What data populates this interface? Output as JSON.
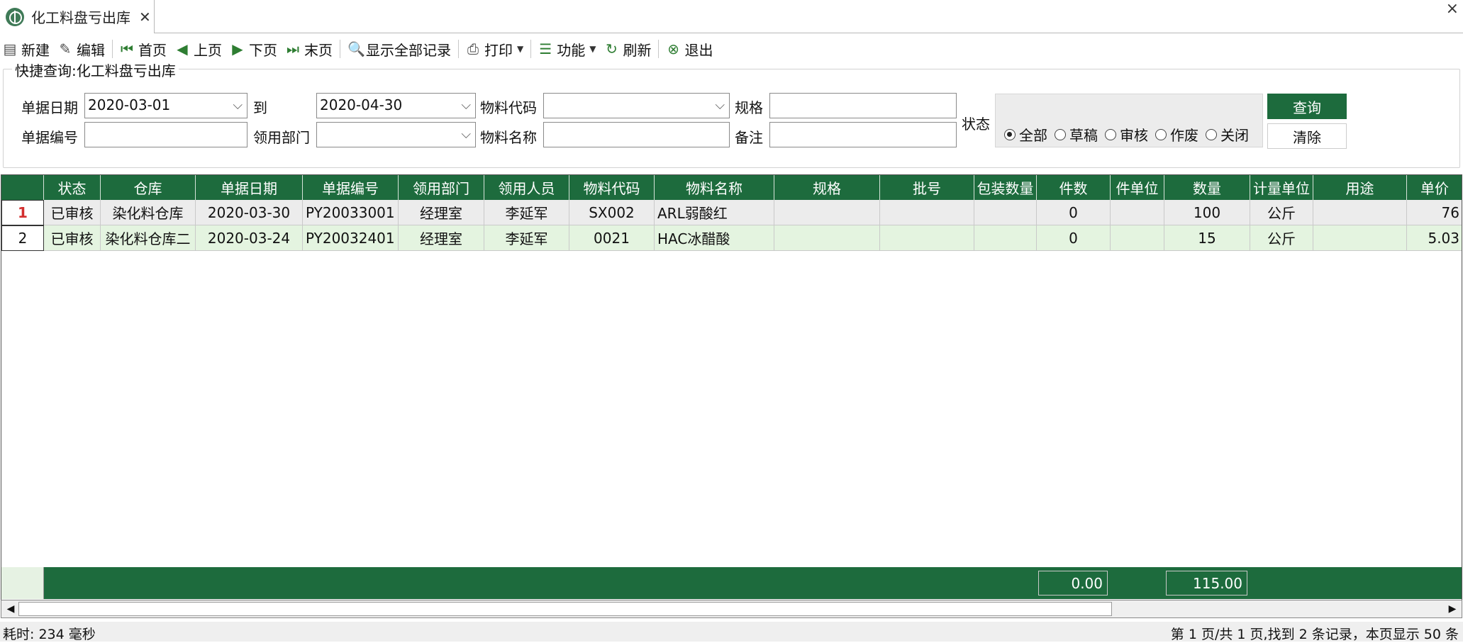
{
  "tab": {
    "title": "化工料盘亏出库",
    "close": "✕"
  },
  "window_close": "×",
  "toolbar": {
    "new": "新建",
    "edit": "编辑",
    "first": "首页",
    "prev": "上页",
    "next": "下页",
    "last": "末页",
    "show_all": "显示全部记录",
    "print": "打印",
    "functions": "功能",
    "refresh": "刷新",
    "exit": "退出"
  },
  "quick_search": {
    "title": "快捷查询:化工料盘亏出库",
    "date_label": "单据日期",
    "date_from": "2020-03-01",
    "to_label": "到",
    "date_to": "2020-04-30",
    "material_code_label": "物料代码",
    "material_code": "",
    "spec_label": "规格",
    "spec": "",
    "doc_no_label": "单据编号",
    "doc_no": "",
    "dept_label": "领用部门",
    "dept": "",
    "material_name_label": "物料名称",
    "material_name": "",
    "remark_label": "备注",
    "remark": "",
    "status_label": "状态",
    "status_options": [
      "全部",
      "草稿",
      "审核",
      "作废",
      "关闭"
    ],
    "status_selected": "全部",
    "query_button": "查询",
    "clear_button": "清除"
  },
  "grid": {
    "columns": [
      "状态",
      "仓库",
      "单据日期",
      "单据编号",
      "领用部门",
      "领用人员",
      "物料代码",
      "物料名称",
      "规格",
      "批号",
      "包装数量",
      "件数",
      "件单位",
      "数量",
      "计量单位",
      "用途",
      "单价"
    ],
    "rows": [
      {
        "num": "1",
        "cells": [
          "已审核",
          "染化料仓库",
          "2020-03-30",
          "PY20033001",
          "经理室",
          "李延军",
          "SX002",
          "ARL弱酸红",
          "",
          "",
          "",
          "0",
          "",
          "100",
          "公斤",
          "",
          "76"
        ]
      },
      {
        "num": "2",
        "cells": [
          "已审核",
          "染化料仓库二",
          "2020-03-24",
          "PY20032401",
          "经理室",
          "李延军",
          "0021",
          "HAC冰醋酸",
          "",
          "",
          "",
          "0",
          "",
          "15",
          "公斤",
          "",
          "5.03"
        ]
      }
    ],
    "totals": {
      "pieces": "0.00",
      "quantity": "115.00"
    }
  },
  "statusbar": {
    "elapsed": "耗时: 234 毫秒",
    "paging": "第 1 页/共 1 页,找到 2 条记录，本页显示 50 条"
  },
  "colors": {
    "accent": "#1d6b3d",
    "row_alt": "#e4f4e0",
    "row_sel": "#ececec"
  }
}
